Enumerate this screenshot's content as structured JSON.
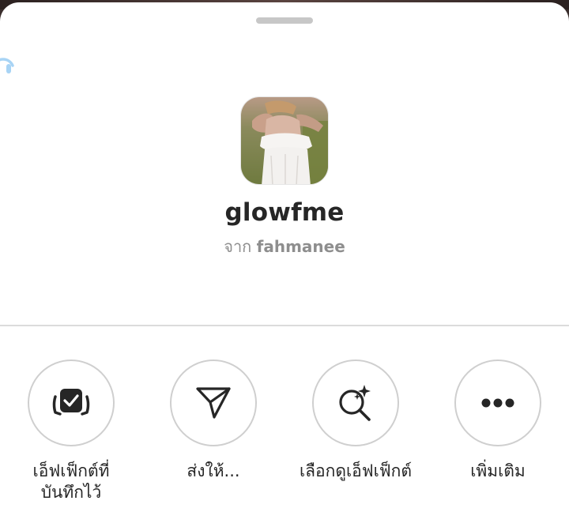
{
  "effect": {
    "name": "glowfme",
    "by_prefix": "จาก",
    "creator": "fahmanee"
  },
  "actions": [
    {
      "label_line1": "เอ็ฟเฟ็กต์ที่",
      "label_line2": "บันทึกไว้",
      "icon": "saved-effects-icon"
    },
    {
      "label_line1": "ส่งให้...",
      "label_line2": "",
      "icon": "send-icon"
    },
    {
      "label_line1": "เลือกดูเอ็ฟเฟ็กต์",
      "label_line2": "",
      "icon": "browse-effects-icon"
    },
    {
      "label_line1": "เพิ่มเติม",
      "label_line2": "",
      "icon": "more-icon"
    }
  ],
  "colors": {
    "sheet_background": "#ffffff",
    "primary_text": "#262626",
    "secondary_text": "#8e8e8e",
    "circle_border": "#cfcfcf",
    "side_icon": "#a8d4f5"
  }
}
